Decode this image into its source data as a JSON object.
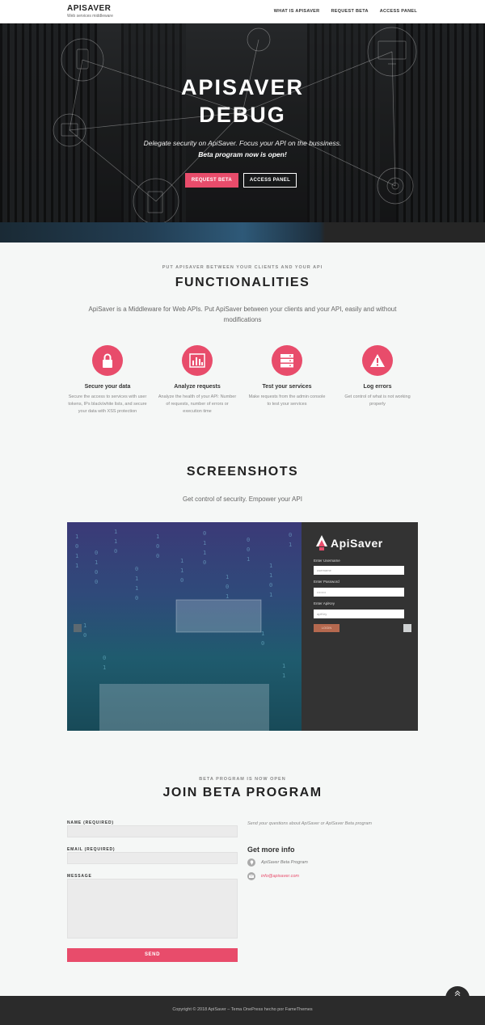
{
  "header": {
    "brand": "APISAVER",
    "tagline": "Web services middleware",
    "nav": [
      "WHAT IS APISAVER",
      "REQUEST BETA",
      "ACCESS PANEL"
    ]
  },
  "hero": {
    "title_line1": "APISAVER",
    "title_line2": "DEBUG",
    "subtitle": "Delegate security on ApiSaver. Focus your API on the bussiness.",
    "subtitle2": "Beta program now is open!",
    "btn_request": "REQUEST BETA",
    "btn_access": "ACCESS PANEL"
  },
  "functionalities": {
    "kicker": "PUT APISAVER BETWEEN YOUR CLIENTS AND YOUR API",
    "title": "FUNCTIONALITIES",
    "description": "ApiSaver is a Middleware for Web APIs. Put ApiSaver between your clients and your API, easily and without modifications",
    "features": [
      {
        "icon": "lock-icon",
        "title": "Secure your data",
        "desc": "Secure the access to services with user tokens, IPs black/white lists, and secure your data with XSS protection"
      },
      {
        "icon": "bar-chart-icon",
        "title": "Analyze requests",
        "desc": "Analyze the health of your API: Number of requests, number of errors or execution time"
      },
      {
        "icon": "server-icon",
        "title": "Test your services",
        "desc": "Make requests from the admin console to test your services"
      },
      {
        "icon": "warning-icon",
        "title": "Log errors",
        "desc": "Get control of what is not working properly"
      }
    ]
  },
  "screenshots": {
    "title": "SCREENSHOTS",
    "subtitle": "Get control of security. Empower your API",
    "panel": {
      "logo": "ApiSaver",
      "username_label": "Enter Username",
      "username_placeholder": "username",
      "password_label": "Enter Password",
      "password_placeholder": "••••••••",
      "apikey_label": "Enter ApiKey",
      "apikey_placeholder": "apiKey",
      "login_label": "LOGIN"
    }
  },
  "beta": {
    "kicker": "BETA PROGRAM IS NOW OPEN",
    "title": "JOIN BETA PROGRAM",
    "name_label": "NAME (REQUIRED)",
    "email_label": "EMAIL (REQUIRED)",
    "message_label": "MESSAGE",
    "send_label": "SEND",
    "side_text": "Send your questions about ApiSaver or ApiSaver Beta program",
    "more_info": "Get more info",
    "contact_program": "ApiSaver Beta Program",
    "contact_email": "info@apisaver.com",
    "accent_color": "#e84c6b"
  },
  "footer": {
    "text": "Copyright © 2018 ApiSaver – Tema OnePress hecho por FameThemes"
  }
}
